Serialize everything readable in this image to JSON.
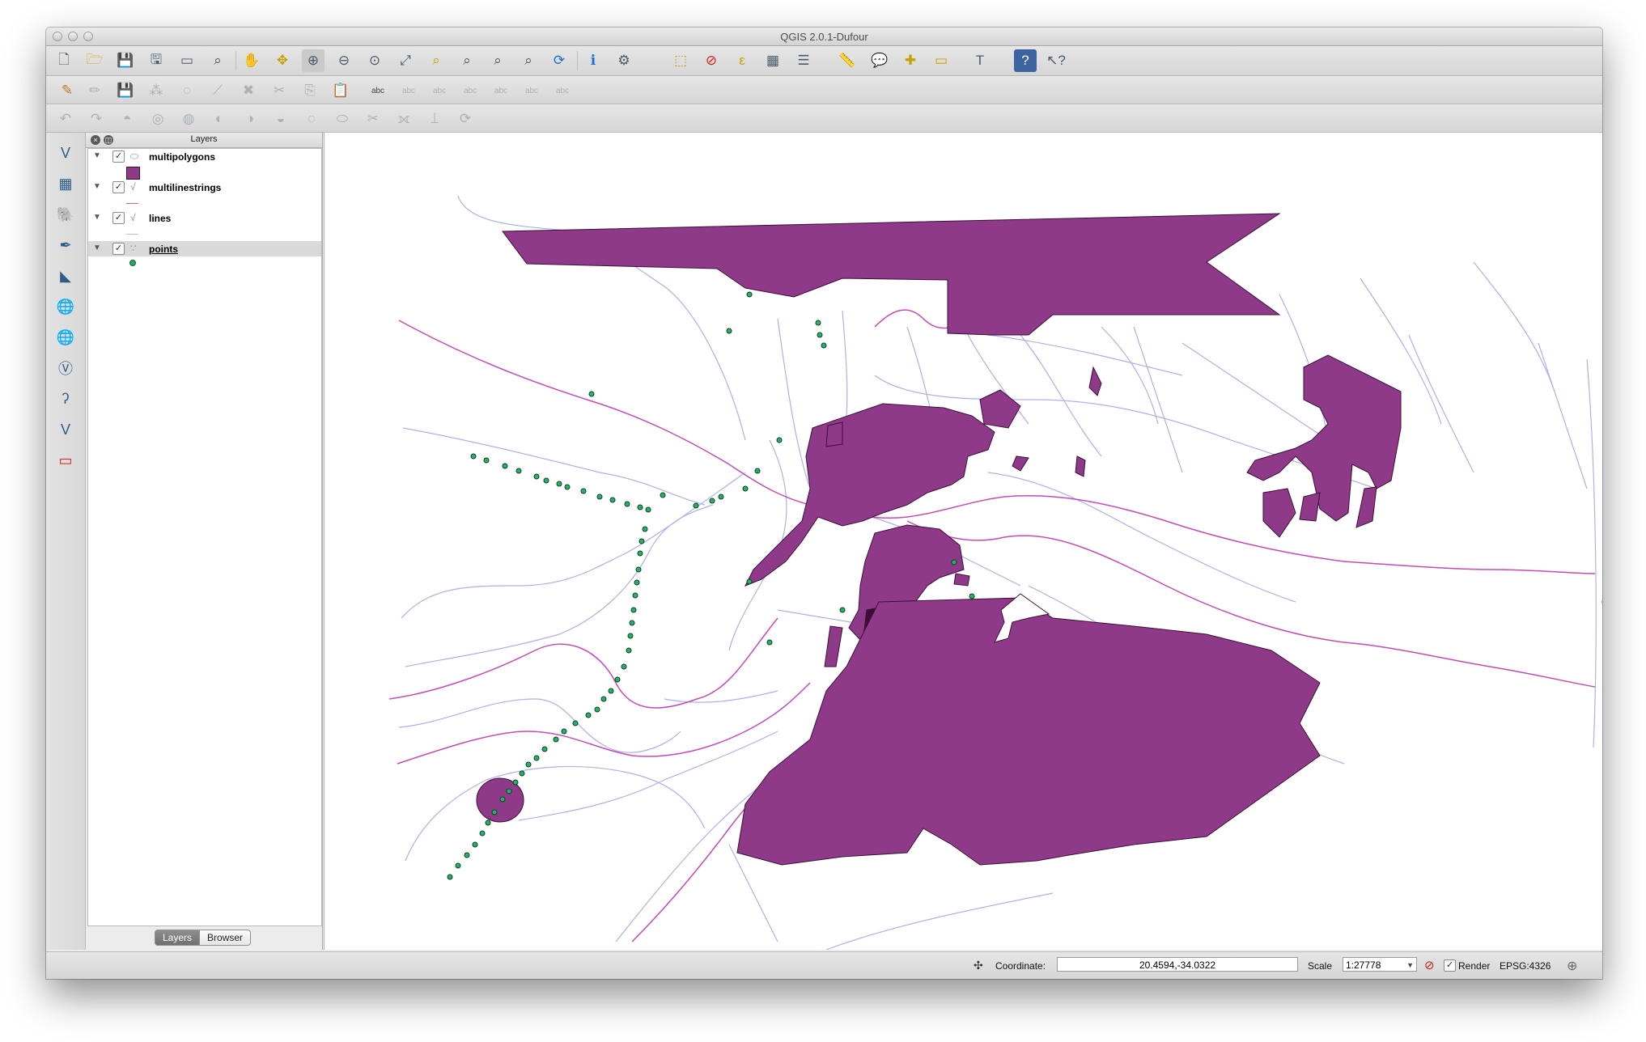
{
  "window": {
    "title": "QGIS 2.0.1-Dufour"
  },
  "toolbar_icons": [
    "new-project",
    "open-project",
    "save-project",
    "save-as",
    "new-print-composer",
    "composer-manager",
    "pan",
    "pan-to-selection",
    "zoom-in",
    "zoom-out",
    "zoom-actual",
    "zoom-full",
    "zoom-to-selection",
    "zoom-to-layer",
    "zoom-last",
    "zoom-next",
    "refresh",
    "identify",
    "select",
    "select-by-expression",
    "deselect",
    "field-calculator",
    "attribute-table",
    "statistics",
    "measure",
    "map-tips",
    "new-bookmark",
    "show-bookmarks",
    "text-annotation",
    "help",
    "whats-this"
  ],
  "panel": {
    "title": "Layers",
    "layers": [
      {
        "name": "multipolygons",
        "checked": true,
        "geometry": "polygon",
        "symbol_color": "#8e3a89"
      },
      {
        "name": "multilinestrings",
        "checked": true,
        "geometry": "line",
        "symbol_color": "#c95db7"
      },
      {
        "name": "lines",
        "checked": true,
        "geometry": "line",
        "symbol_color": "#b9b9e6"
      },
      {
        "name": "points",
        "checked": true,
        "geometry": "point",
        "symbol_color": "#25a867",
        "selected": true
      }
    ],
    "tabs": {
      "layers": "Layers",
      "browser": "Browser"
    }
  },
  "map": {
    "polygon_fill": "#8e3a89",
    "polygon_stroke": "#3a0f37",
    "road_color": "#c34bb5",
    "line_color": "#aeb0e6",
    "point_fill": "#22b56a"
  },
  "status": {
    "coordinate_label": "Coordinate:",
    "coordinate_value": "20.4594,-34.0322",
    "scale_label": "Scale",
    "scale_value": "1:27778",
    "render_label": "Render",
    "render_checked": true,
    "crs": "EPSG:4326"
  }
}
